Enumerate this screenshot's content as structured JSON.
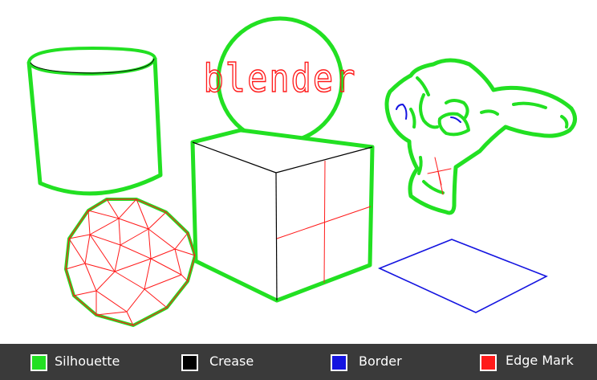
{
  "scene": {
    "logo_text": "blender",
    "stroke_colors": {
      "silhouette": "#22e022",
      "crease": "#000000",
      "border": "#1414e0",
      "edge_mark": "#ff1a1a"
    },
    "objects": [
      "cylinder-icon",
      "sphere-icon",
      "cube-icon",
      "monkey-head-icon",
      "icosphere-icon",
      "plane-icon"
    ]
  },
  "legend": {
    "items": [
      {
        "label": "Silhouette",
        "color": "#22e022"
      },
      {
        "label": "Crease",
        "color": "#000000"
      },
      {
        "label": "Border",
        "color": "#1414e0"
      },
      {
        "label": "Edge Mark",
        "color": "#ff1a1a"
      }
    ]
  }
}
